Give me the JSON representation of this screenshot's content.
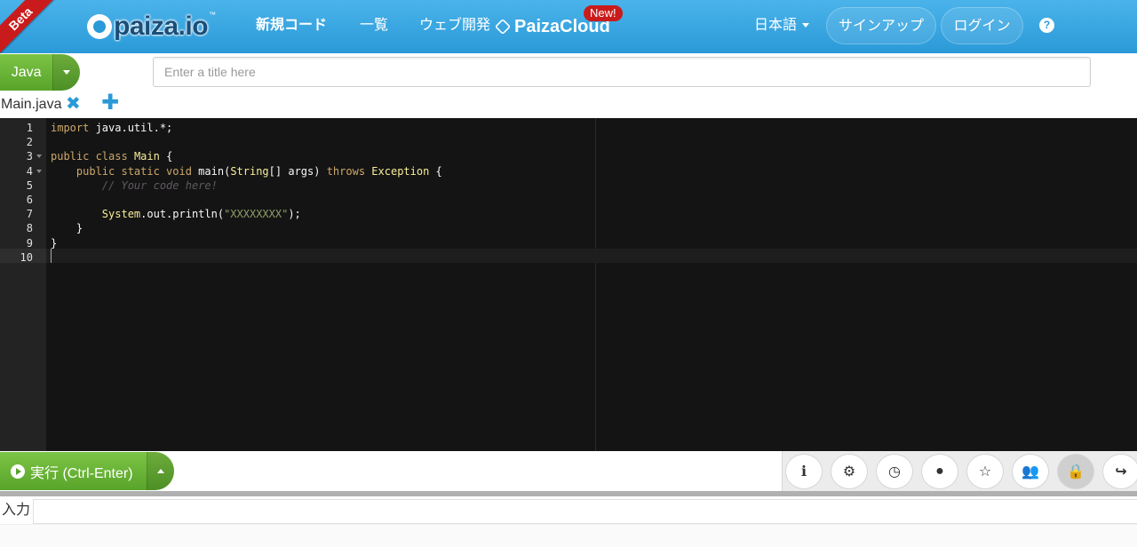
{
  "header": {
    "beta_label": "Beta",
    "logo_text": "paiza.io",
    "logo_tm": "™",
    "nav": {
      "new_code": "新規コード",
      "list": "一覧",
      "web_dev": "ウェブ開発",
      "paizacloud": "PaizaCloud",
      "new_badge": "New!"
    },
    "language": "日本語",
    "signup": "サインアップ",
    "login": "ログイン",
    "help": "?"
  },
  "editor_top": {
    "language_button": "Java",
    "title_placeholder": "Enter a title here",
    "file_tab": "Main.java",
    "close_glyph": "✖",
    "add_glyph": "✚"
  },
  "code": {
    "line_numbers": [
      "1",
      "2",
      "3",
      "4",
      "5",
      "6",
      "7",
      "8",
      "9",
      "10"
    ],
    "lines": [
      [
        {
          "t": "import",
          "c": "kw"
        },
        {
          "t": " java.util.*;",
          "c": "pl"
        }
      ],
      [],
      [
        {
          "t": "public class",
          "c": "kw"
        },
        {
          "t": " ",
          "c": "pl"
        },
        {
          "t": "Main",
          "c": "ty"
        },
        {
          "t": " {",
          "c": "pl"
        }
      ],
      [
        {
          "t": "    public static void",
          "c": "kw"
        },
        {
          "t": " main(",
          "c": "pl"
        },
        {
          "t": "String",
          "c": "ty"
        },
        {
          "t": "[] args) ",
          "c": "pl"
        },
        {
          "t": "throws",
          "c": "kw"
        },
        {
          "t": " ",
          "c": "pl"
        },
        {
          "t": "Exception",
          "c": "ty"
        },
        {
          "t": " {",
          "c": "pl"
        }
      ],
      [
        {
          "t": "        // Your code here!",
          "c": "cm"
        }
      ],
      [],
      [
        {
          "t": "        ",
          "c": "pl"
        },
        {
          "t": "System",
          "c": "ty"
        },
        {
          "t": ".out.println(",
          "c": "pl"
        },
        {
          "t": "\"XXXXXXXX\"",
          "c": "st"
        },
        {
          "t": ");",
          "c": "pl"
        }
      ],
      [
        {
          "t": "    }",
          "c": "pl"
        }
      ],
      [
        {
          "t": "}",
          "c": "pl"
        }
      ],
      []
    ],
    "fold_lines": [
      3,
      4
    ]
  },
  "toolbar": {
    "run_label": "実行 (Ctrl-Enter)",
    "tools": [
      {
        "name": "info-icon",
        "glyph": "ℹ"
      },
      {
        "name": "gear-icon",
        "glyph": "⚙"
      },
      {
        "name": "history-icon",
        "glyph": "◷"
      },
      {
        "name": "github-icon",
        "glyph": "●"
      },
      {
        "name": "star-icon",
        "glyph": "☆"
      },
      {
        "name": "group-icon",
        "glyph": "👥"
      },
      {
        "name": "lock-icon",
        "glyph": "🔒"
      },
      {
        "name": "share-icon",
        "glyph": "↪"
      }
    ]
  },
  "input_section": {
    "label": "入力"
  },
  "colors": {
    "header_blue": "#2a9ad8",
    "accent_green": "#58a42a",
    "beta_red": "#c91b1b",
    "editor_bg": "#141414"
  }
}
